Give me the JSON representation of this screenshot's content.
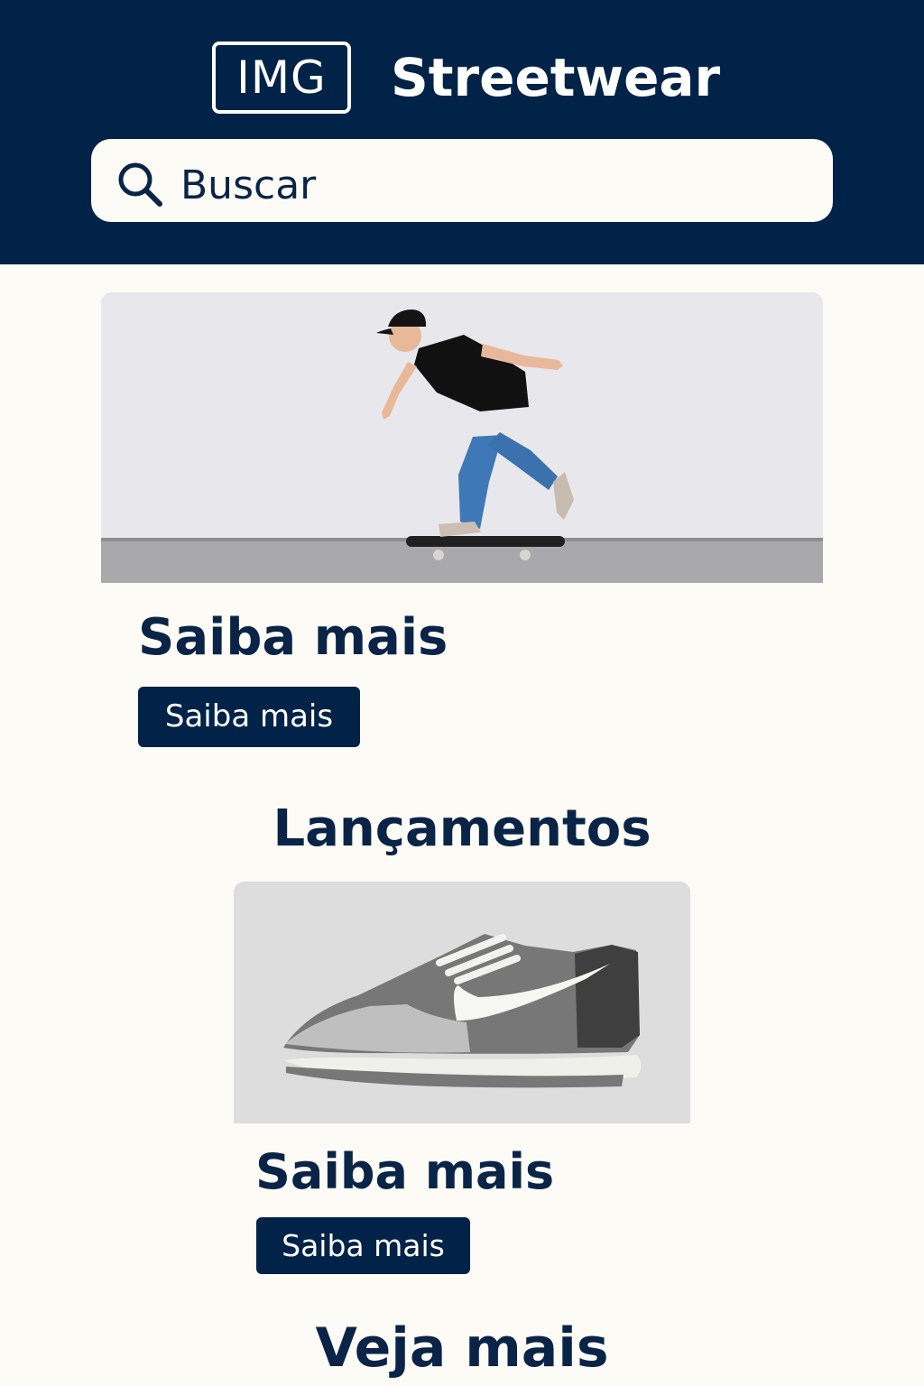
{
  "header": {
    "logo_text": "IMG",
    "brand": "Streetwear",
    "search_placeholder": "Buscar",
    "background": "#002347"
  },
  "hero": {
    "image_icon": "skateboarder-image",
    "title": "Saiba mais",
    "button_label": "Saiba mais"
  },
  "launches": {
    "title": "Lançamentos",
    "product_icon": "sneaker-image",
    "product_title": "Saiba mais",
    "product_button": "Saiba mais"
  },
  "more": {
    "title": "Veja mais"
  },
  "colors": {
    "navy": "#002347",
    "page": "#fdfbf5"
  }
}
